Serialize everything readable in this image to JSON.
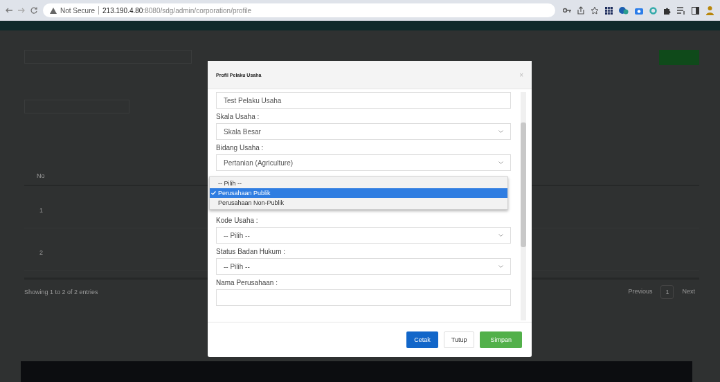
{
  "browser": {
    "security": "Not Secure",
    "url_host": "213.190.4.80",
    "url_path": ":8080/sdg/admin/corporation/profile"
  },
  "background_table": {
    "header_no": "No",
    "rows": [
      "1",
      "2"
    ],
    "footer": "Showing 1 to 2 of 2 entries",
    "pagination": [
      {
        "label": "Previous",
        "selected": false
      },
      {
        "label": "1",
        "selected": true
      },
      {
        "label": "Next",
        "selected": false
      }
    ]
  },
  "modal": {
    "title": "Profil Pelaku Usaha",
    "close": "×",
    "fields": [
      {
        "kind": "text",
        "value": "Test Pelaku Usaha"
      },
      {
        "kind": "select",
        "label": "Skala Usaha :",
        "value": "Skala Besar"
      },
      {
        "kind": "select",
        "label": "Bidang Usaha :",
        "value": "Pertanian (Agriculture)"
      },
      {
        "kind": "open-select",
        "options": [
          {
            "label": "-- Pilih --",
            "selected": false
          },
          {
            "label": "Perusahaan Publik",
            "selected": true
          },
          {
            "label": "Perusahaan Non-Publik",
            "selected": false
          }
        ]
      },
      {
        "kind": "select",
        "label": "Kode Usaha :",
        "value": "-- Pilih --"
      },
      {
        "kind": "select",
        "label": "Status Badan Hukum :",
        "value": "-- Pilih --"
      },
      {
        "kind": "text",
        "label": "Nama Perusahaan :"
      }
    ],
    "buttons": [
      {
        "kind": "primary",
        "label": "Cetak"
      },
      {
        "kind": "default",
        "label": "Tutup"
      },
      {
        "kind": "success",
        "label": "Simpan"
      }
    ]
  }
}
